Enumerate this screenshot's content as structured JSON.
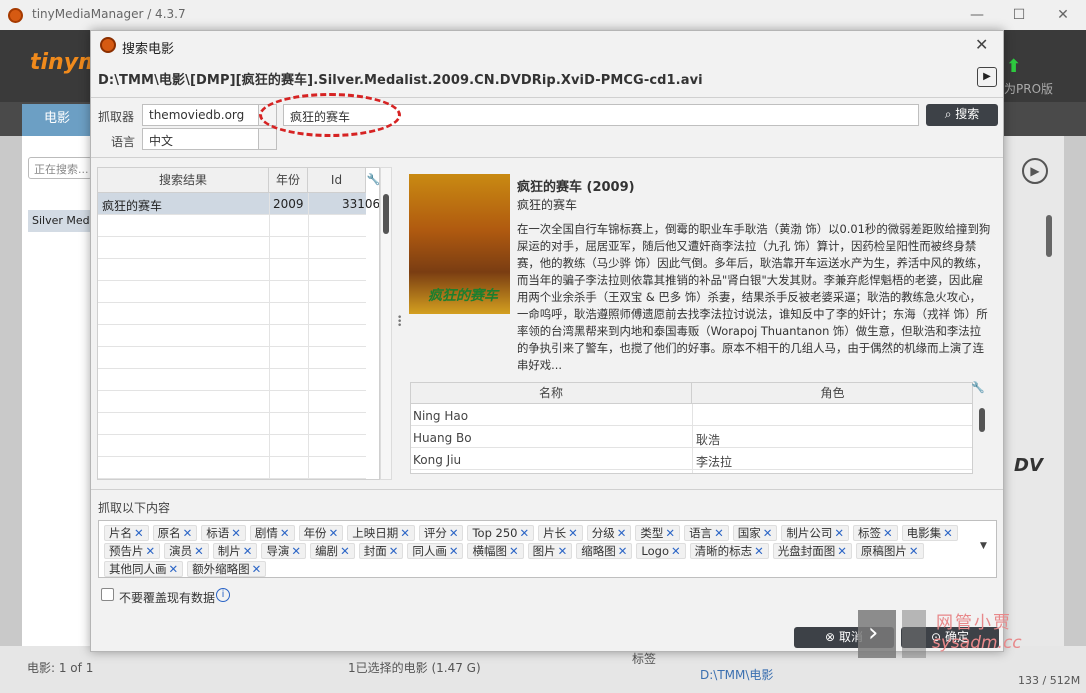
{
  "window": {
    "title": "tinyMediaManager / 4.3.7",
    "logo": "tinym",
    "pro_text": "为PRO版",
    "movies_tab": "电影",
    "search_placeholder": "正在搜索...",
    "selected_item": "Silver Med"
  },
  "statusbar": {
    "left": "电影: 1 of 1",
    "middle": "1已选择的电影 (1.47 G)",
    "label": "标签",
    "path": "D:\\TMM\\电影",
    "size": "133 / 512M"
  },
  "dialog": {
    "title": "搜索电影",
    "file": "D:\\TMM\\电影\\[DMP][疯狂的赛车].Silver.Medalist.2009.CN.DVDRip.XviD-PMCG-cd1.avi",
    "scraper_label": "抓取器",
    "scraper_value": "themoviedb.org",
    "query_value": "疯狂的赛车",
    "search_button": "搜索",
    "language_label": "语言",
    "language_value": "中文",
    "results": {
      "columns": [
        "搜索结果",
        "年份",
        "Id"
      ],
      "rows": [
        {
          "title": "疯狂的赛车",
          "year": "2009",
          "id": "33106"
        }
      ]
    },
    "movie": {
      "title": "疯狂的赛车 (2009)",
      "original_title": "疯狂的赛车",
      "poster_text": "疯狂的赛车",
      "plot": "在一次全国自行车锦标赛上，倒霉的职业车手耿浩（黄渤 饰）以0.01秒的微弱差距败给撞到狗屎运的对手，屈居亚军，随后他又遭奸商李法拉（九孔 饰）算计，因药检呈阳性而被终身禁赛，他的教练（马少骅 饰）因此气倒。多年后，耿浩靠开车运送水产为生，养活中风的教练，而当年的骗子李法拉则依靠其推销的补品\"肾白银\"大发其财。李兼弃彪悍魁梧的老婆，因此雇用两个业余杀手（王双宝 & 巴多 饰）杀妻，结果杀手反被老婆采逼；耿浩的教练急火攻心，一命呜呼，耿浩遵照师傅遗愿前去找李法拉讨说法，谁知反中了李的奸计；东海（戎祥 饰）所率领的台湾黑帮来到内地和泰国毒贩（Worapoj Thuantanon 饰）做生意，但耿浩和李法拉的争执引来了警车，也搅了他们的好事。原本不相干的几组人马，由于偶然的机缘而上演了连串好戏..."
    },
    "cast": {
      "columns": [
        "名称",
        "角色"
      ],
      "rows": [
        {
          "name": "Ning Hao",
          "role": ""
        },
        {
          "name": "Huang Bo",
          "role": "耿浩"
        },
        {
          "name": "Kong Jiu",
          "role": "李法拉"
        }
      ]
    },
    "scrape_label": "抓取以下内容",
    "chips": [
      "片名",
      "原名",
      "标语",
      "剧情",
      "年份",
      "上映日期",
      "评分",
      "Top 250",
      "片长",
      "分级",
      "类型",
      "语言",
      "国家",
      "制片公司",
      "标签",
      "电影集",
      "预告片",
      "演员",
      "制片",
      "导演",
      "编剧",
      "封面",
      "同人画",
      "横幅图",
      "图片",
      "缩略图",
      "Logo",
      "清晰的标志",
      "光盘封面图",
      "原稿图片",
      "其他同人画",
      "额外缩略图"
    ],
    "checkbox_label": "不要覆盖现有数据",
    "cancel_button": "取消",
    "ok_button": "确定"
  },
  "watermark": {
    "line1": "网管小贾",
    "line2": "sysadm.cc"
  }
}
